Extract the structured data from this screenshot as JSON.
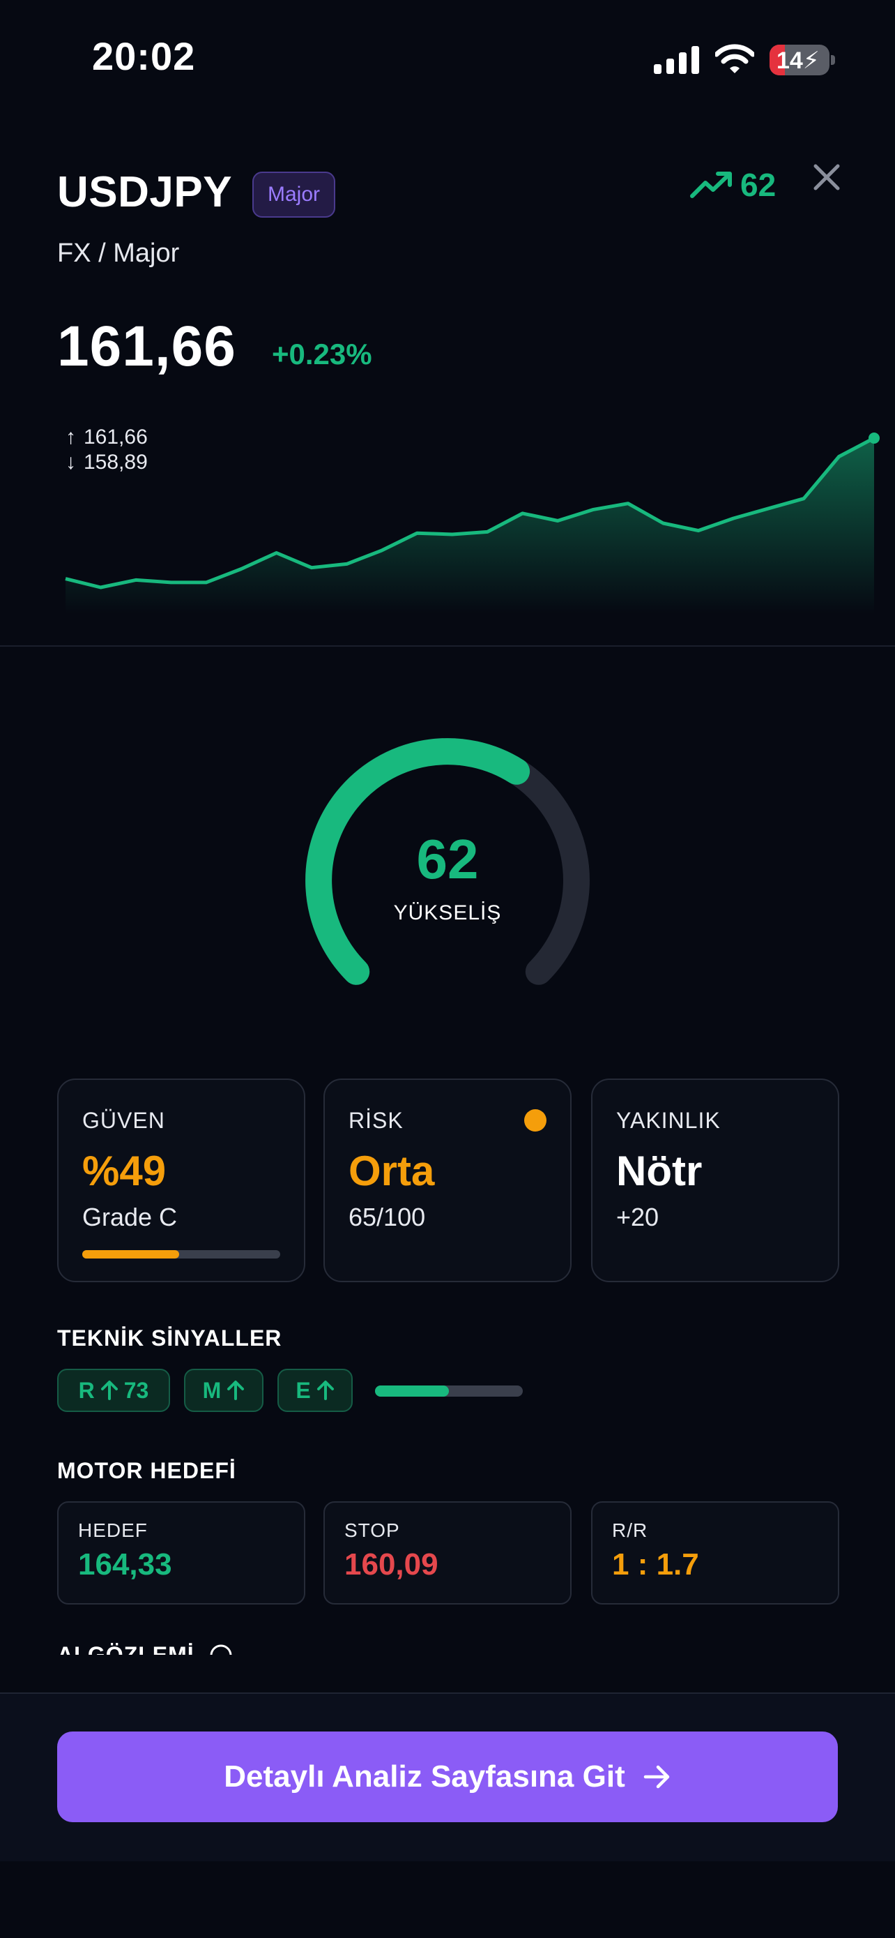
{
  "status_bar": {
    "time": "20:02",
    "battery": "14"
  },
  "header": {
    "symbol": "USDJPY",
    "badge": "Major",
    "subtitle": "FX / Major",
    "score": "62",
    "price": "161,66",
    "change": "+0.23%",
    "high": "161,66",
    "low": "158,89"
  },
  "chart_data": {
    "type": "area",
    "y": [
      158.89,
      158.82,
      158.88,
      158.86,
      158.86,
      158.97,
      159.1,
      158.98,
      159.01,
      159.12,
      159.26,
      159.25,
      159.27,
      159.42,
      159.36,
      159.45,
      159.5,
      159.34,
      159.28,
      159.38,
      159.46,
      159.54,
      159.88,
      160.03
    ],
    "color": "#18b97e"
  },
  "gauge": {
    "value": 62,
    "max": 100,
    "label": "YÜKSELİŞ",
    "color": "#18b97e",
    "track": "#242834"
  },
  "metrics": [
    {
      "label": "GÜVEN",
      "value": "%49",
      "sub": "Grade C",
      "value_color": "#f59e0b",
      "progress": 0.49
    },
    {
      "label": "RİSK",
      "value": "Orta",
      "sub": "65/100",
      "value_color": "#f59e0b",
      "dot_color": "#f59e0b"
    },
    {
      "label": "YAKINLIK",
      "value": "Nötr",
      "sub": "+20",
      "value_color": "#ffffff"
    }
  ],
  "signals": {
    "title": "TEKNİK SİNYALLER",
    "chips": [
      {
        "letter": "R",
        "direction": "up",
        "value": "73"
      },
      {
        "letter": "M",
        "direction": "up"
      },
      {
        "letter": "E",
        "direction": "up"
      }
    ],
    "strength": 0.5
  },
  "targets": {
    "title": "MOTOR HEDEFİ",
    "items": [
      {
        "label": "HEDEF",
        "value": "164,33",
        "color": "#18b97e"
      },
      {
        "label": "STOP",
        "value": "160,09",
        "color": "#e5484d"
      },
      {
        "label": "R/R",
        "value": "1 : 1.7",
        "color": "#f59e0b"
      }
    ]
  },
  "next_section": {
    "title": "AI GÖZLEMİ"
  },
  "cta": {
    "label": "Detaylı Analiz Sayfasına Git"
  }
}
